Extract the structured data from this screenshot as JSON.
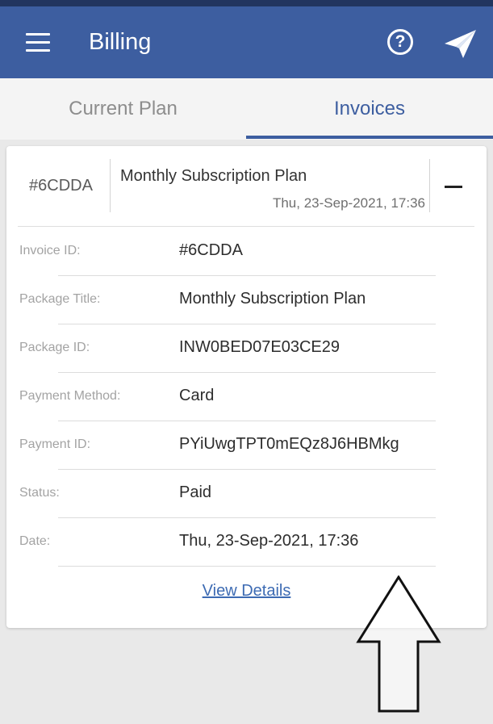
{
  "app_bar": {
    "title": "Billing",
    "menu_icon": "hamburger-menu-icon",
    "help_icon": "help-circle-icon",
    "help_glyph": "?",
    "send_icon": "paper-plane-icon",
    "color": "#3d5ea0"
  },
  "tabs": [
    {
      "label": "Current Plan",
      "active": false
    },
    {
      "label": "Invoices",
      "active": true
    }
  ],
  "invoice_card": {
    "id": "#6CDDA",
    "plan_name": "Monthly Subscription Plan",
    "date": "Thu, 23-Sep-2021, 17:36",
    "expanded": true,
    "details": [
      {
        "label": "Invoice ID:",
        "value": "#6CDDA"
      },
      {
        "label": "Package Title:",
        "value": "Monthly Subscription Plan"
      },
      {
        "label": "Package ID:",
        "value": "INW0BED07E03CE29"
      },
      {
        "label": "Payment Method:",
        "value": "Card"
      },
      {
        "label": "Payment ID:",
        "value": "PYiUwgTPT0mEQz8J6HBMkg"
      },
      {
        "label": "Status:",
        "value": "Paid"
      },
      {
        "label": "Date:",
        "value": "Thu, 23-Sep-2021, 17:36"
      }
    ],
    "view_details_label": "View Details"
  },
  "annotation": {
    "icon": "up-arrow-outline-icon"
  }
}
